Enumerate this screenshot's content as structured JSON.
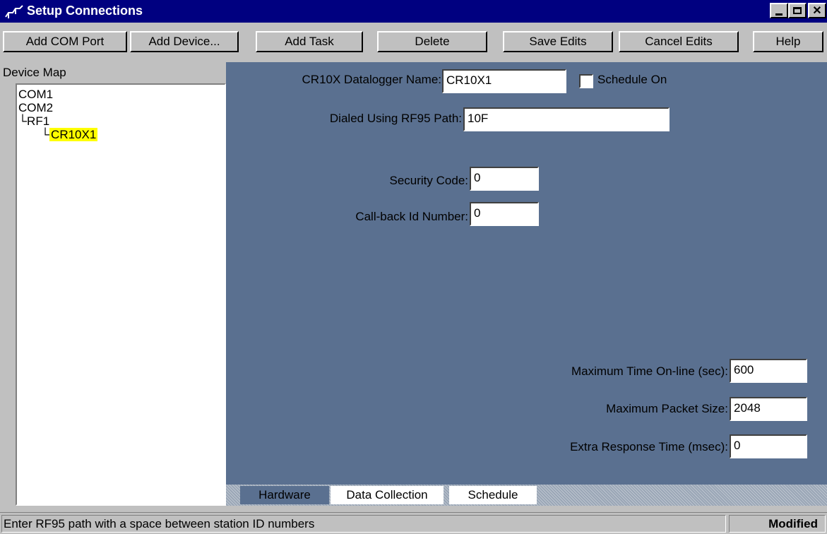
{
  "window": {
    "title": "Setup Connections"
  },
  "toolbar": {
    "add_com_port": "Add COM Port",
    "add_device": "Add Device...",
    "add_task": "Add Task",
    "delete": "Delete",
    "save_edits": "Save Edits",
    "cancel_edits": "Cancel Edits",
    "help": "Help"
  },
  "device_map": {
    "label": "Device Map",
    "items": [
      {
        "label": "COM1"
      },
      {
        "label": "COM2"
      },
      {
        "label": "RF1"
      },
      {
        "label": "CR10X1",
        "selected": true
      }
    ]
  },
  "form": {
    "name_label": "CR10X Datalogger Name:",
    "name_value": "CR10X1",
    "schedule_label": "Schedule On",
    "schedule_checked": false,
    "path_label": "Dialed Using RF95  Path:",
    "path_value": "10F",
    "security_label": "Security Code:",
    "security_value": "0",
    "callback_label": "Call-back Id Number:",
    "callback_value": "0",
    "max_time_label": "Maximum Time On-line (sec):",
    "max_time_value": "600",
    "max_packet_label": "Maximum Packet Size:",
    "max_packet_value": "2048",
    "extra_response_label": "Extra Response Time (msec):",
    "extra_response_value": "0"
  },
  "tabs": [
    {
      "label": "Hardware",
      "active": true
    },
    {
      "label": "Data Collection",
      "active": false
    },
    {
      "label": "Schedule",
      "active": false
    }
  ],
  "status": {
    "message": "Enter RF95 path with a space between station ID numbers",
    "state": "Modified"
  },
  "colors": {
    "title_bar": "#000080",
    "panel": "#5a7090",
    "selection_highlight": "#ffff00"
  }
}
